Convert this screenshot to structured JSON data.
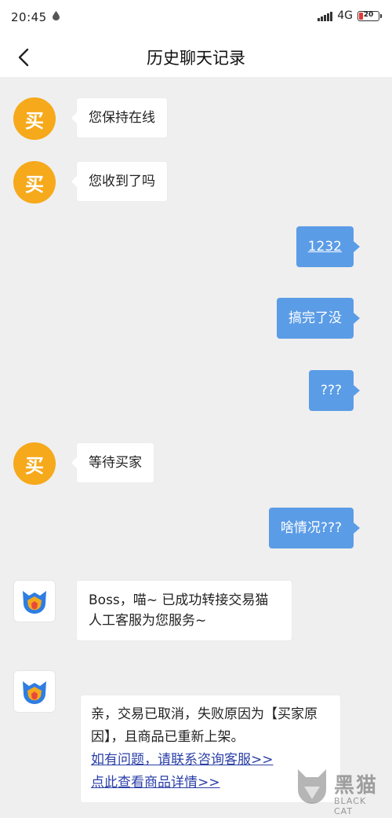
{
  "status_bar": {
    "time": "20:45",
    "network": "4G",
    "battery": "20"
  },
  "header": {
    "title": "历史聊天记录"
  },
  "messages": [
    {
      "sender": "buyer",
      "avatar_text": "买",
      "text": "您保持在线"
    },
    {
      "sender": "buyer",
      "avatar_text": "买",
      "text": "您收到了吗"
    },
    {
      "sender": "me",
      "text": "1232"
    },
    {
      "sender": "me",
      "text": "搞完了没"
    },
    {
      "sender": "me",
      "text": "???"
    },
    {
      "sender": "buyer",
      "avatar_text": "买",
      "text": "等待买家"
    },
    {
      "sender": "me",
      "text": "啥情况???"
    },
    {
      "sender": "bot",
      "line1": "Boss，喵~ 已成功转接交易猫",
      "line2": "人工客服为您服务~"
    },
    {
      "sender": "bot",
      "line1": "亲，交易已取消，失败原因为【买家原",
      "line2": "因】，且商品已重新上架。",
      "link1": "如有问题，请联系咨询客服>>",
      "link2": "点此查看商品详情>>"
    }
  ],
  "watermark": {
    "text": "黑猫",
    "sub": "BLACK CAT"
  },
  "colors": {
    "buyer_avatar": "#f6a91b",
    "my_bubble": "#5b9ce6",
    "link": "#2a3fa7"
  }
}
